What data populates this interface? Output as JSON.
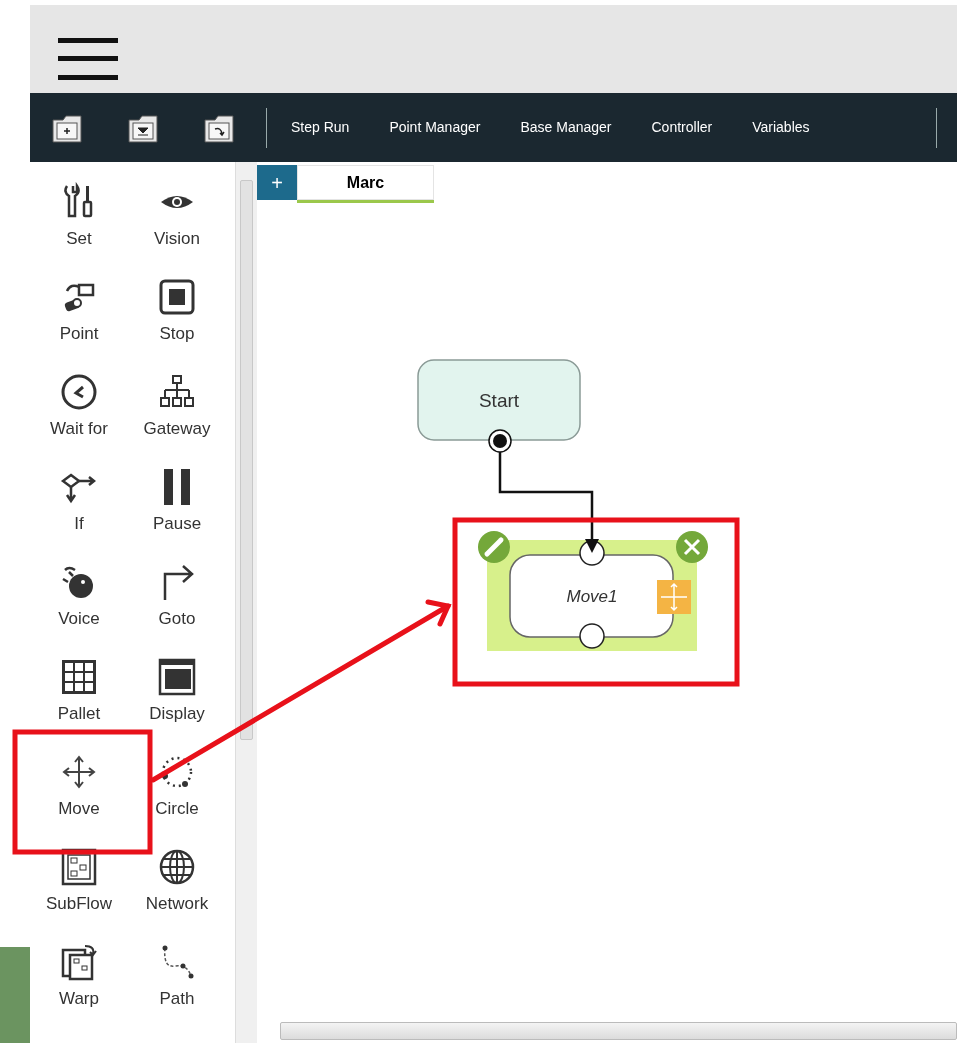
{
  "toolbar": {
    "items": [
      "Step Run",
      "Point Manager",
      "Base Manager",
      "Controller",
      "Variables"
    ]
  },
  "palette": {
    "items": [
      {
        "label": "Set"
      },
      {
        "label": "Vision"
      },
      {
        "label": "Point"
      },
      {
        "label": "Stop"
      },
      {
        "label": "Wait for"
      },
      {
        "label": "Gateway"
      },
      {
        "label": "If"
      },
      {
        "label": "Pause"
      },
      {
        "label": "Voice"
      },
      {
        "label": "Goto"
      },
      {
        "label": "Pallet"
      },
      {
        "label": "Display"
      },
      {
        "label": "Move"
      },
      {
        "label": "Circle"
      },
      {
        "label": "SubFlow"
      },
      {
        "label": "Network"
      },
      {
        "label": "Warp"
      },
      {
        "label": "Path"
      }
    ]
  },
  "add_tab_button": {
    "label": "+"
  },
  "tabs": [
    {
      "label": "Marc",
      "selected": true
    }
  ],
  "flow": {
    "nodes": [
      {
        "kind": "start",
        "label": "Start"
      },
      {
        "kind": "move",
        "label": "Move1",
        "selected": true
      }
    ]
  }
}
